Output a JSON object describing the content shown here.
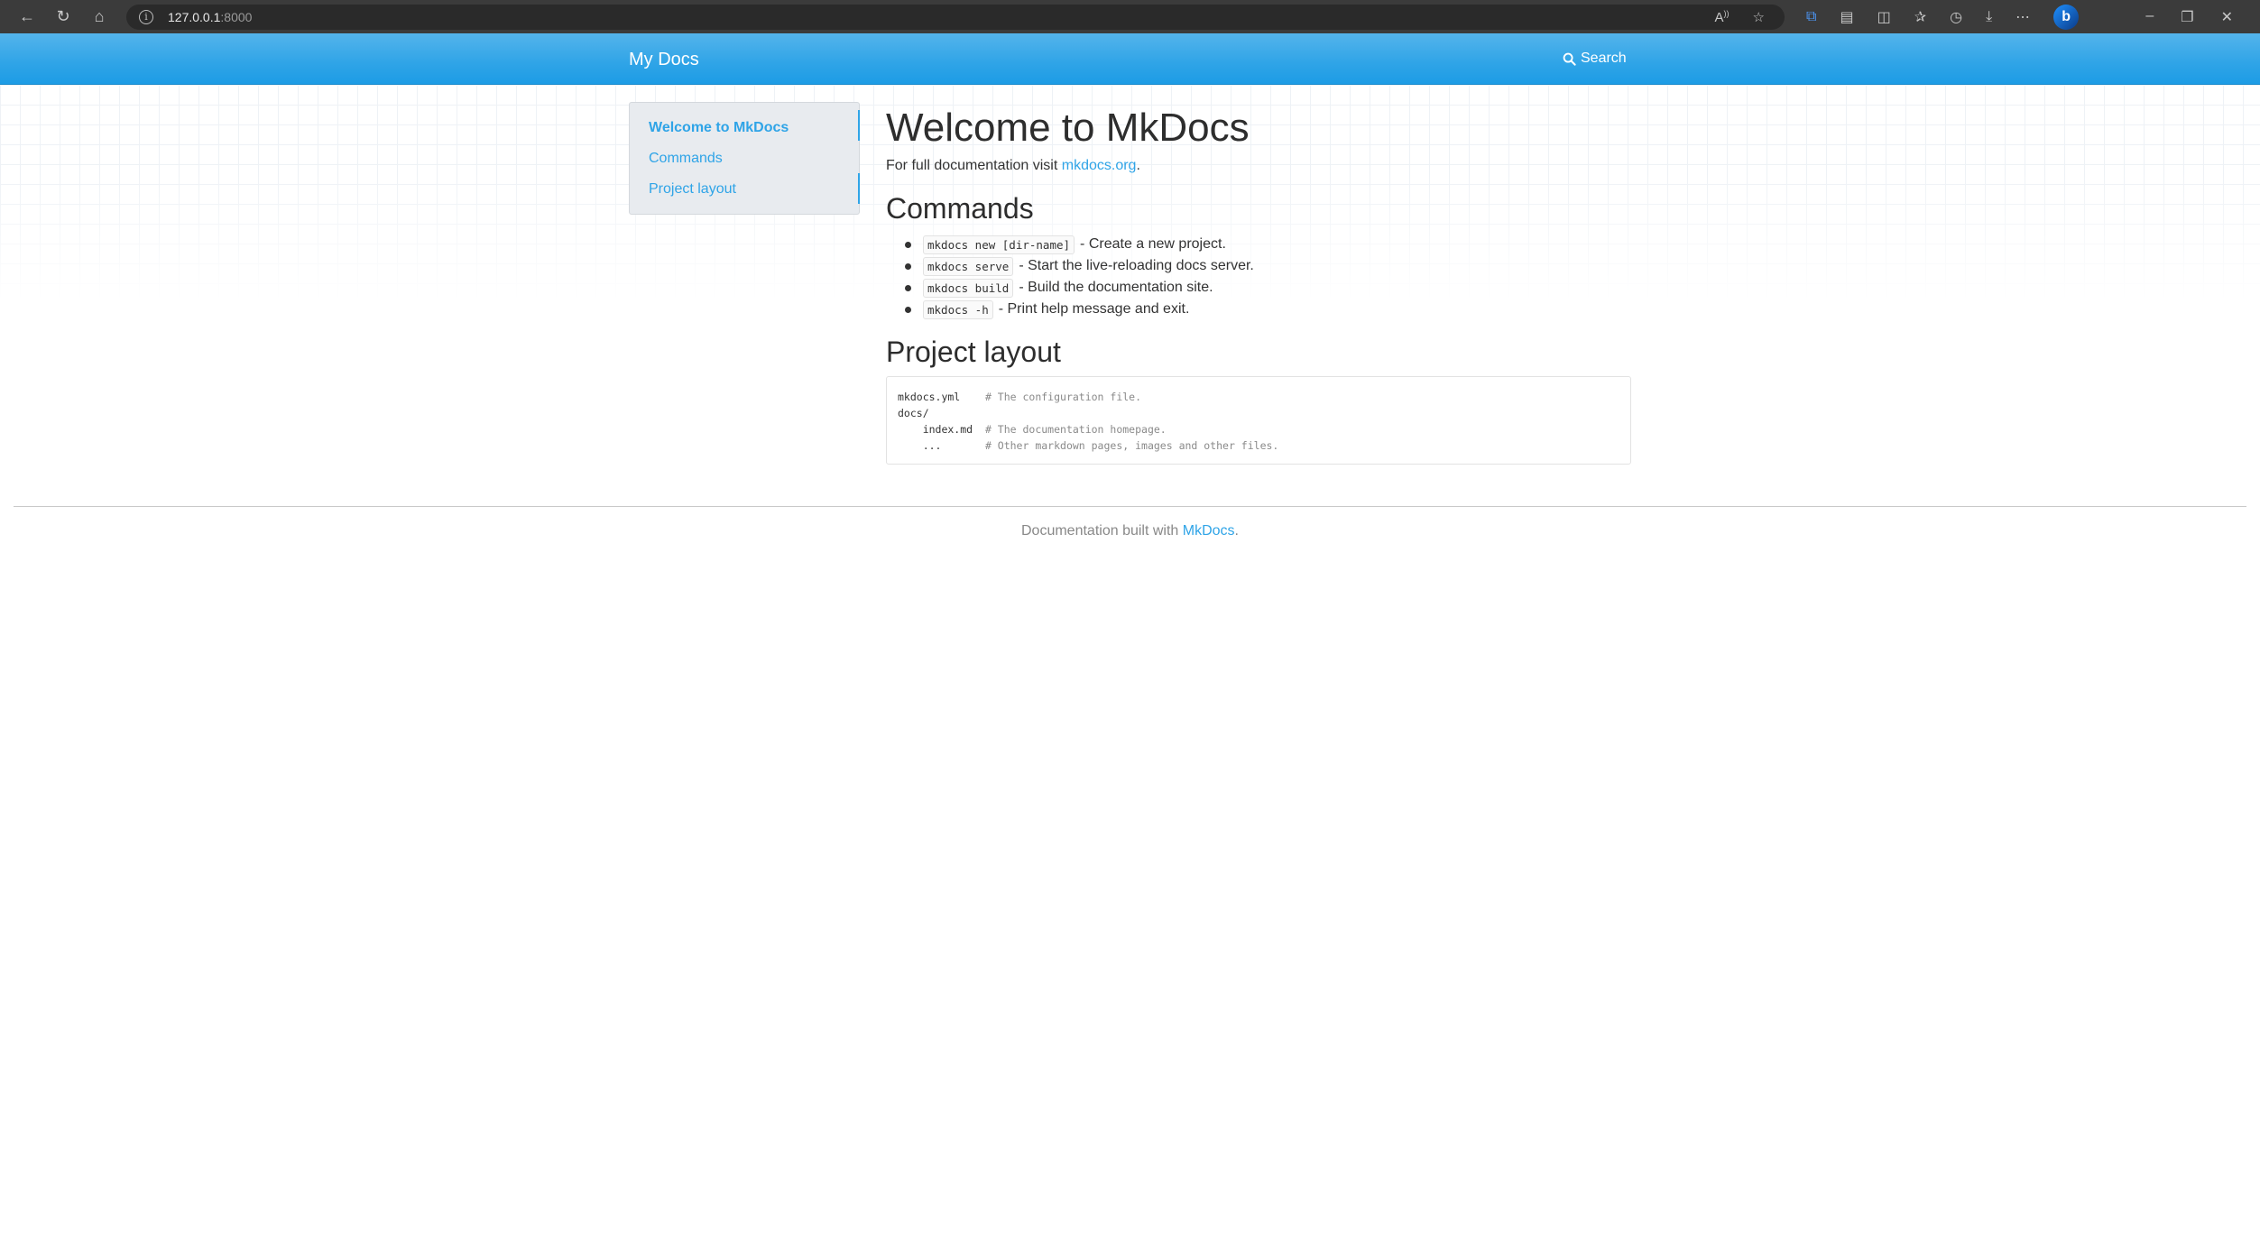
{
  "browser": {
    "host": "127.0.0.1",
    "port": ":8000"
  },
  "navbar": {
    "brand": "My Docs",
    "search_label": "Search"
  },
  "sidebar": {
    "items": [
      {
        "label": "Welcome to MkDocs",
        "active": true
      },
      {
        "label": "Commands",
        "active": false
      },
      {
        "label": "Project layout",
        "active": false
      }
    ]
  },
  "main": {
    "title": "Welcome to MkDocs",
    "lead_prefix": "For full documentation visit ",
    "lead_link": "mkdocs.org",
    "lead_suffix": ".",
    "commands_heading": "Commands",
    "commands": [
      {
        "code": "mkdocs new [dir-name]",
        "desc": "- Create a new project."
      },
      {
        "code": "mkdocs serve",
        "desc": "- Start the live-reloading docs server."
      },
      {
        "code": "mkdocs build",
        "desc": "- Build the documentation site."
      },
      {
        "code": "mkdocs -h",
        "desc": "- Print help message and exit."
      }
    ],
    "layout_heading": "Project layout",
    "layout_lines": [
      {
        "text": "mkdocs.yml    ",
        "comment": "# The configuration file."
      },
      {
        "text": "docs/",
        "comment": ""
      },
      {
        "text": "    index.md  ",
        "comment": "# The documentation homepage."
      },
      {
        "text": "    ...       ",
        "comment": "# Other markdown pages, images and other files."
      }
    ]
  },
  "footer": {
    "prefix": "Documentation built with ",
    "link": "MkDocs",
    "suffix": "."
  },
  "colors": {
    "accent": "#2fa4e7",
    "chrome": "#3b3b3b"
  }
}
